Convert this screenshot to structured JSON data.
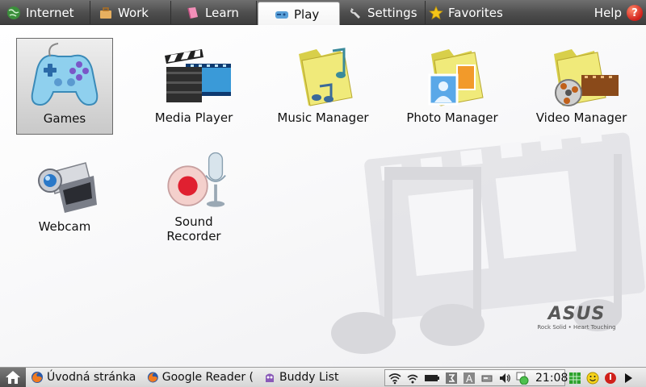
{
  "tabs": [
    {
      "label": "Internet",
      "icon": "globe-icon"
    },
    {
      "label": "Work",
      "icon": "briefcase-icon"
    },
    {
      "label": "Learn",
      "icon": "book-icon"
    },
    {
      "label": "Play",
      "icon": "game-icon",
      "active": true
    },
    {
      "label": "Settings",
      "icon": "wrench-icon"
    },
    {
      "label": "Favorites",
      "icon": "star-icon"
    }
  ],
  "help": {
    "label": "Help",
    "icon": "help-icon",
    "glyph": "?"
  },
  "apps": [
    {
      "label": "Games",
      "icon": "gamepad-icon",
      "selected": true
    },
    {
      "label": "Media Player",
      "icon": "clapperboard-icon"
    },
    {
      "label": "Music Manager",
      "icon": "music-folder-icon"
    },
    {
      "label": "Photo Manager",
      "icon": "photo-folder-icon"
    },
    {
      "label": "Video Manager",
      "icon": "video-folder-icon"
    },
    {
      "label": "Webcam",
      "icon": "webcam-icon"
    },
    {
      "label": "Sound Recorder",
      "icon": "microphone-icon"
    }
  ],
  "brand": {
    "logo": "ASUS",
    "tagline": "Rock Solid • Heart Touching"
  },
  "taskbar": {
    "items": [
      {
        "label": "Úvodná stránka",
        "icon": "firefox-icon"
      },
      {
        "label": "Google Reader (",
        "icon": "firefox-icon"
      },
      {
        "label": "Buddy List",
        "icon": "pidgin-icon"
      }
    ],
    "clock": "21:08"
  },
  "colors": {
    "topbar": "#4d4d4d",
    "active_tab": "#ffffff",
    "accent_red": "#d0201a"
  }
}
